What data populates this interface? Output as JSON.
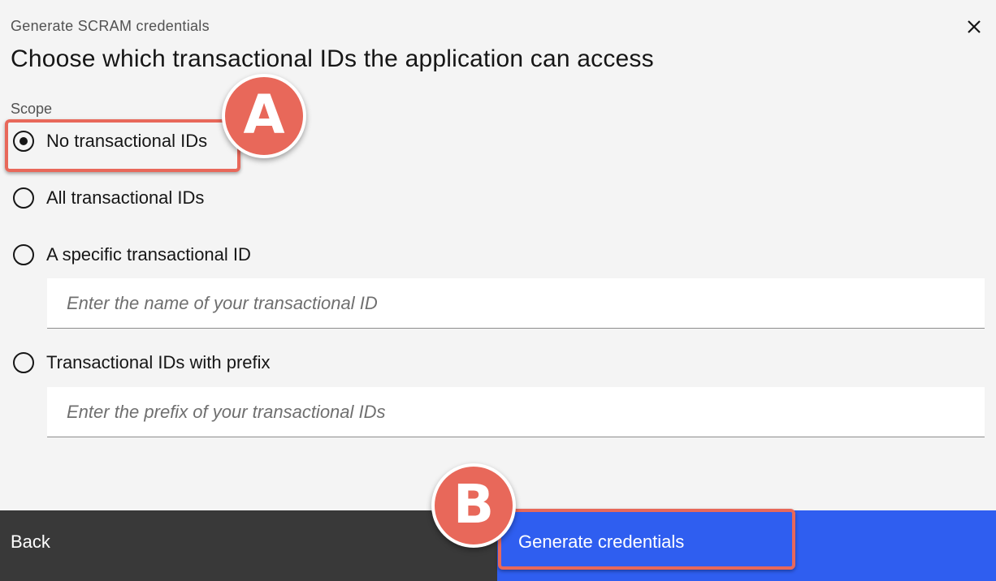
{
  "modal": {
    "label": "Generate SCRAM credentials",
    "heading": "Choose which transactional IDs the application can access",
    "close_icon": "close-icon"
  },
  "scope": {
    "label": "Scope",
    "options": [
      {
        "label": "No transactional IDs",
        "selected": true
      },
      {
        "label": "All transactional IDs",
        "selected": false
      },
      {
        "label": "A specific transactional ID",
        "selected": false
      },
      {
        "label": "Transactional IDs with prefix",
        "selected": false
      }
    ],
    "specific_placeholder": "Enter the name of your transactional ID",
    "prefix_placeholder": "Enter the prefix of your transactional IDs"
  },
  "footer": {
    "back_label": "Back",
    "generate_label": "Generate credentials"
  },
  "annotations": {
    "a": "A",
    "b": "B",
    "color": "#e8685a"
  },
  "colors": {
    "primary_button": "#2f5ef0",
    "secondary_button": "#393939",
    "background": "#f4f4f4"
  }
}
